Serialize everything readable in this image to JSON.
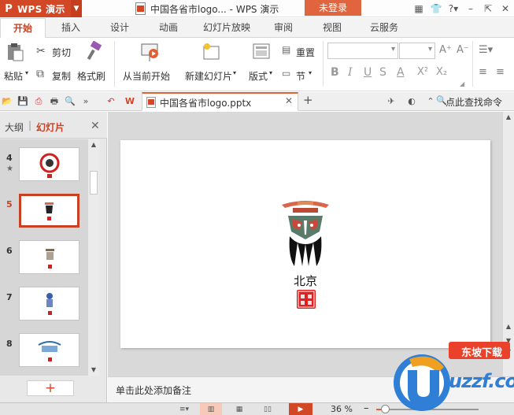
{
  "titlebar": {
    "app_logo_letter": "P",
    "app_name": "WPS 演示",
    "window_title": "中国各省市logo... - WPS 演示",
    "login_label": "未登录"
  },
  "tabs": [
    {
      "label": "开始"
    },
    {
      "label": "插入"
    },
    {
      "label": "设计"
    },
    {
      "label": "动画"
    },
    {
      "label": "幻灯片放映"
    },
    {
      "label": "审阅"
    },
    {
      "label": "视图"
    },
    {
      "label": "云服务"
    }
  ],
  "ribbon": {
    "paste": "粘贴",
    "cut": "剪切",
    "copy": "复制",
    "format_painter": "格式刷",
    "from_current": "从当前开始",
    "new_slide": "新建幻灯片",
    "layout": "版式",
    "reset": "重置",
    "section": "节",
    "bold": "B",
    "italic": "I",
    "underline": "U",
    "strike": "S",
    "font_color": "A",
    "superscript": "X²",
    "subscript": "X₂",
    "grow_font": "A⁺",
    "shrink_font": "A⁻"
  },
  "quickbar": {
    "doc_tab": "中国各省市logo.pptx",
    "search_cmd": "点此查找命令"
  },
  "leftpane": {
    "tab_outline": "大纲",
    "tab_slides": "幻灯片",
    "slides": [
      {
        "num": "4"
      },
      {
        "num": "5"
      },
      {
        "num": "6"
      },
      {
        "num": "7"
      },
      {
        "num": "8"
      }
    ],
    "add_label": "+"
  },
  "slide": {
    "city": "北京",
    "stamp_text": "大好河山"
  },
  "notes": {
    "placeholder": "单击此处添加备注"
  },
  "status": {
    "zoom": "36 %",
    "zoom_value": 36
  },
  "watermark": {
    "text": "uzzf.com",
    "badge": "东坡下载"
  },
  "colors": {
    "accent": "#d24726",
    "login": "#e0643e"
  }
}
